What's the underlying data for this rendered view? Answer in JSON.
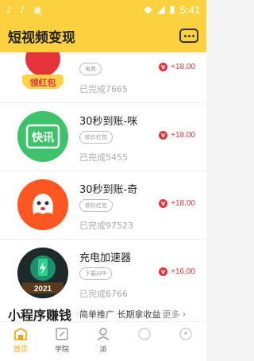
{
  "status_bar": {
    "time": "5:41",
    "left_icons": [
      "tiktok-icon",
      "tiktok-icon",
      "app-icon"
    ],
    "right_icons": [
      "wifi-icon",
      "signal-icon",
      "battery-icon"
    ]
  },
  "header": {
    "title": "短视频变现",
    "more_icon": "more-dots-icon"
  },
  "colors": {
    "header_bg": "#fcd13f",
    "reward_red": "#e5323b",
    "active_tab": "#f0a200"
  },
  "items": [
    {
      "name": "",
      "tag": "电商",
      "completed": "已完成7665",
      "reward": "+18.00",
      "icon_text": "领红包"
    },
    {
      "name": "30秒到账-咪",
      "tag": "软价红包",
      "completed": "已完成5455",
      "reward": "+18.00",
      "icon_text": "快讯"
    },
    {
      "name": "30秒到账-奇",
      "tag": "软价红包",
      "completed": "已完成97523",
      "reward": "+18.00",
      "icon_text": ""
    },
    {
      "name": "充电加速器",
      "tag": "下载APP",
      "completed": "已完成6766",
      "reward": "+16.00",
      "icon_text": "2021"
    }
  ],
  "reward_badge": "V",
  "section": {
    "title": "小程序赚钱",
    "subtitle": "简单推广 长期拿收益",
    "more": "更多",
    "chevron": "›"
  },
  "tabs": [
    {
      "label": "首页",
      "icon": "home-icon",
      "active": true
    },
    {
      "label": "学院",
      "icon": "edit-icon",
      "active": false
    },
    {
      "label": "派",
      "icon": "user-icon",
      "active": false
    },
    {
      "label": "",
      "icon": "circle-icon",
      "active": false
    },
    {
      "label": "",
      "icon": "profile-icon",
      "active": false
    }
  ]
}
